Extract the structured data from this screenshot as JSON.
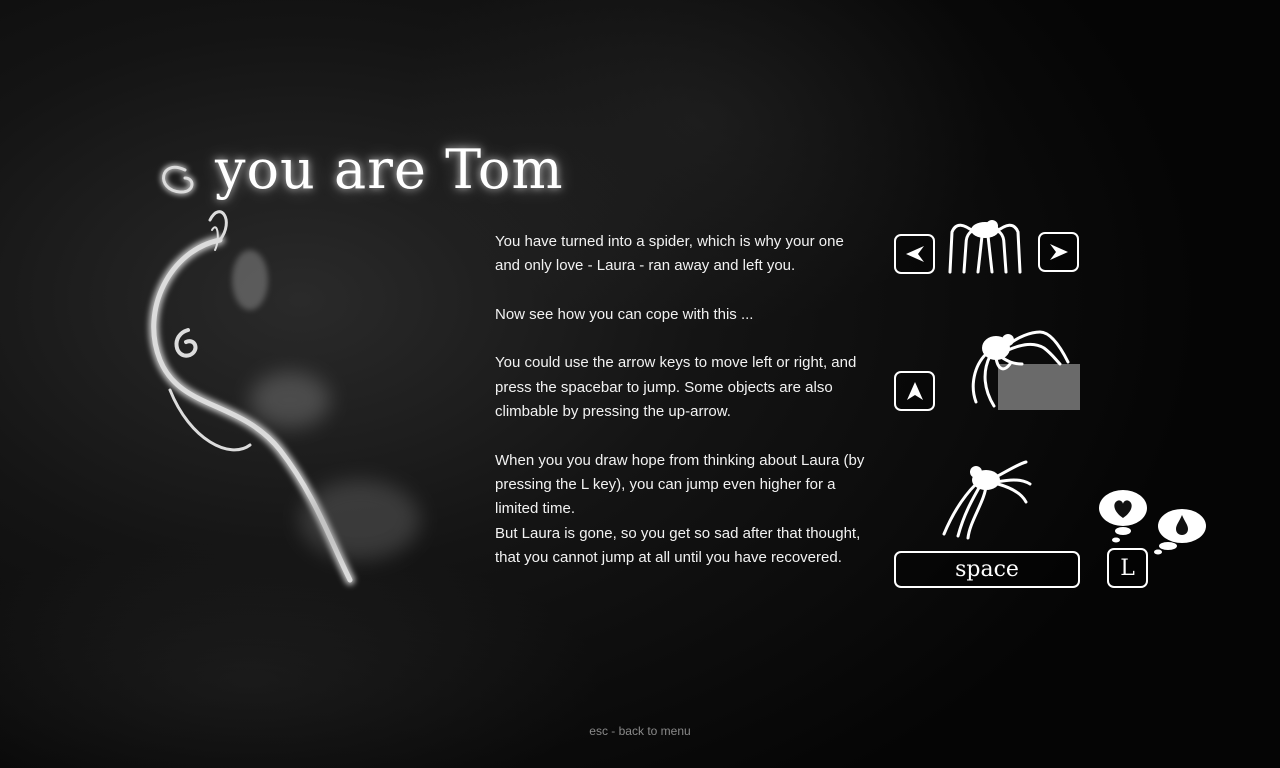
{
  "title": "you are Tom",
  "story": {
    "intro": "You have turned into a spider, which is why your one and only love - Laura - ran away and left you.",
    "cope": "Now see how you can cope with this ...",
    "controls": "You could use the arrow keys to move left or right, and press the spacebar to jump. Some objects are also climbable by pressing the up-arrow.",
    "hope": "When you you draw hope from thinking about Laura (by pressing the L key), you can jump even higher for a limited time.",
    "sad": "But Laura is gone, so you get so sad after that thought, that you cannot jump at all until you have recovered."
  },
  "keys": {
    "left": "left-arrow-icon",
    "right": "right-arrow-icon",
    "up": "up-arrow-icon",
    "space_label": "space",
    "l_label": "L"
  },
  "footer": "esc - back to menu",
  "colors": {
    "background": "#0a0a0a",
    "text": "#ffffff",
    "block": "#6a6a6a",
    "footer": "#8a8a8a"
  }
}
